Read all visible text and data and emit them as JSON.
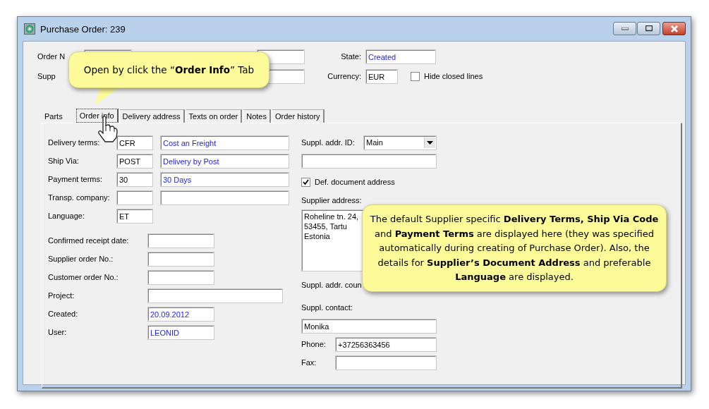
{
  "window": {
    "title": "Purchase Order: 239"
  },
  "header": {
    "order_no_label": "Order N",
    "supplier_label": "Supp",
    "state": {
      "label": "State:",
      "value": "Created"
    },
    "currency": {
      "label": "Currency:",
      "value": "EUR"
    },
    "hide_closed_lines": {
      "label": "Hide closed lines",
      "checked": false
    }
  },
  "tabs": [
    {
      "label": "Parts",
      "selected": false
    },
    {
      "label": "Order info",
      "selected": true
    },
    {
      "label": "Delivery address",
      "selected": false
    },
    {
      "label": "Texts on order",
      "selected": false
    },
    {
      "label": "Notes",
      "selected": false
    },
    {
      "label": "Order history",
      "selected": false
    }
  ],
  "terms": [
    {
      "label": "Delivery terms:",
      "code": "CFR",
      "description": "Cost an Freight"
    },
    {
      "label": "Ship Via:",
      "code": "POST",
      "description": "Delivery by Post"
    },
    {
      "label": "Payment terms:",
      "code": "30",
      "description": "30 Days"
    },
    {
      "label": "Transp. company:"
    },
    {
      "label": "Language:",
      "code": "ET"
    }
  ],
  "details": [
    {
      "label": "Confirmed receipt date:",
      "wide": false
    },
    {
      "label": "Supplier order No.:",
      "wide": false
    },
    {
      "label": "Customer order No.:",
      "wide": false
    },
    {
      "label": "Project:",
      "wide": true
    },
    {
      "label": "Created:",
      "value": "20.09.2012",
      "wide": false
    },
    {
      "label": "User:",
      "value": "LEONID",
      "wide": false
    }
  ],
  "supplier": {
    "addr_id": {
      "label": "Suppl. addr. ID:",
      "value": "Main"
    },
    "def_document_address": {
      "label": "Def. document address",
      "checked": true
    },
    "address": {
      "label": "Supplier address:",
      "lines": [
        "Roheline tn. 24,",
        "53455, Tartu",
        "Estonia"
      ]
    },
    "country_label": "Suppl. addr. coun",
    "contact": {
      "label": "Suppl. contact:",
      "value": "Monika"
    },
    "phone": {
      "label": "Phone:",
      "value": "+37256363456"
    },
    "fax": {
      "label": "Fax:"
    }
  },
  "callouts": [
    {
      "kind": "tab-hint",
      "text": "Open by click the “**Order Info**” Tab"
    },
    {
      "kind": "fields-note",
      "text": "The default Supplier specific **Delivery Terms, Ship Via Code** and **Payment Terms** are displayed here (they was specified automatically during creating of Purchase Order).  Also, the details for **Supplier’s Document Address** and preferable **Language** are displayed."
    }
  ]
}
